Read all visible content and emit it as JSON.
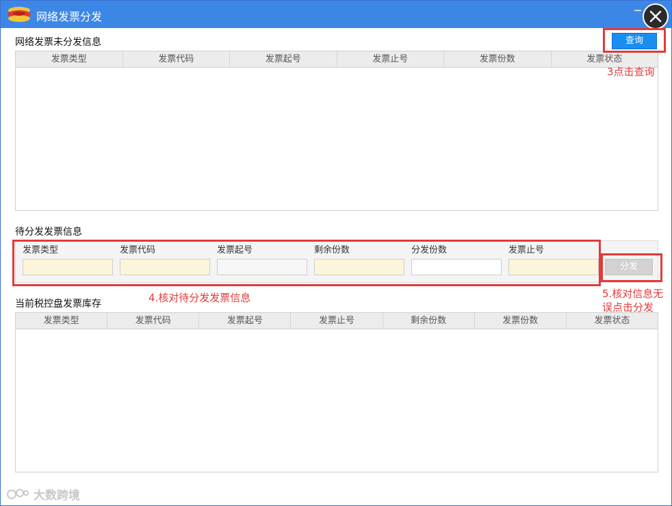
{
  "window": {
    "title": "网络发票分发",
    "minimize_glyph": "─"
  },
  "unassigned": {
    "label": "网络发票未分发信息",
    "query_button": "查询",
    "columns": [
      "发票类型",
      "发票代码",
      "发票起号",
      "发票止号",
      "发票份数",
      "发票状态"
    ],
    "rows": []
  },
  "pending": {
    "label": "待分发发票信息",
    "fields": [
      {
        "label": "发票类型",
        "value": ""
      },
      {
        "label": "发票代码",
        "value": ""
      },
      {
        "label": "发票起号",
        "value": ""
      },
      {
        "label": "剩余份数",
        "value": ""
      },
      {
        "label": "分发份数",
        "value": ""
      },
      {
        "label": "发票止号",
        "value": ""
      }
    ],
    "distribute_button": "分发"
  },
  "inventory": {
    "label": "当前税控盘发票库存",
    "columns": [
      "发票类型",
      "发票代码",
      "发票起号",
      "发票止号",
      "剩余份数",
      "发票份数",
      "发票状态"
    ],
    "rows": []
  },
  "annotations": {
    "step3": "3点击查询",
    "step4": "4.核对待分发发票信息",
    "step5_line1": "5.核对信息无",
    "step5_line2": "误点击分发",
    "color": "#e23a3a"
  },
  "watermark": "大数跨境",
  "colors": {
    "titlebar": "#3c87e6",
    "primary_button": "#1a8df0",
    "disabled_button": "#d2d2d2",
    "highlight_input": "#fdf5d9"
  }
}
